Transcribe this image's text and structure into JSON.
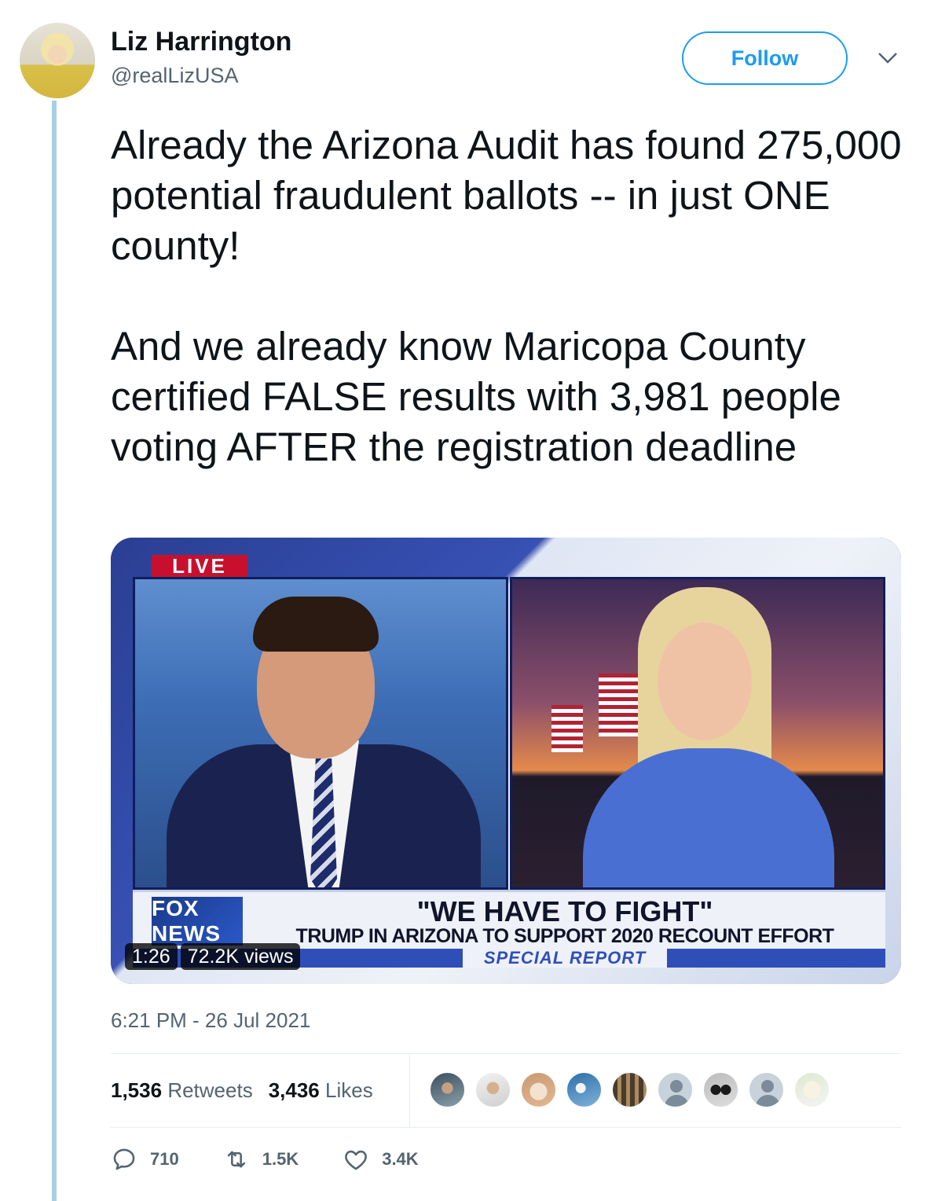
{
  "author": {
    "name": "Liz Harrington",
    "handle": "@realLizUSA"
  },
  "follow_label": "Follow",
  "tweet_text": "Already the Arizona Audit has found 275,000 potential fraudulent ballots -- in just ONE county!\n\nAnd we already know Maricopa County certified FALSE results with 3,981 people voting AFTER the registration deadline",
  "video": {
    "live_label": "LIVE",
    "fox_logo": "FOX NEWS",
    "chyron_headline": "\"WE HAVE TO FIGHT\"",
    "chyron_subline": "TRUMP IN ARIZONA TO SUPPORT 2020 RECOUNT EFFORT",
    "chyron_show": "SPECIAL REPORT",
    "duration": "1:26",
    "views": "72.2K views"
  },
  "timestamp": "6:21 PM - 26 Jul 2021",
  "stats": {
    "retweets_count": "1,536",
    "retweets_label": "Retweets",
    "likes_count": "3,436",
    "likes_label": "Likes"
  },
  "actions": {
    "reply_count": "710",
    "retweet_count": "1.5K",
    "like_count": "3.4K"
  },
  "colors": {
    "accent": "#1d9bf0",
    "thread_line": "#a8cfe6",
    "secondary_text": "#536471"
  }
}
